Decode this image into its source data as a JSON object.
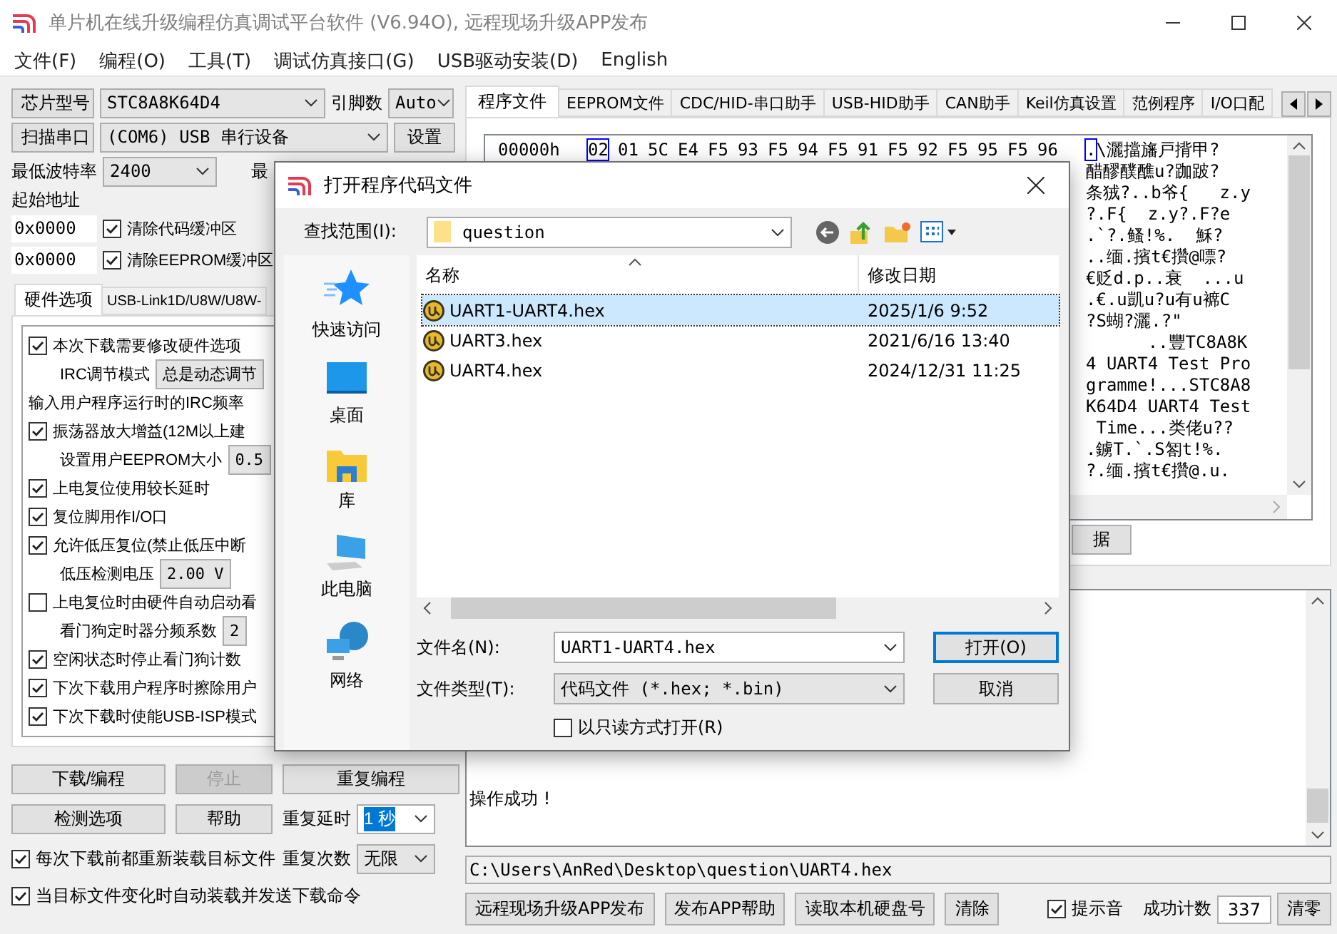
{
  "window": {
    "title": "单片机在线升级编程仿真调试平台软件 (V6.94O), 远程现场升级APP发布"
  },
  "menu": [
    "文件(F)",
    "编程(O)",
    "工具(T)",
    "调试仿真接口(G)",
    "USB驱动安装(D)",
    "English"
  ],
  "left_panel": {
    "chip_button": "芯片型号",
    "chip_model": "STC8A8K64D4",
    "pins_label": "引脚数",
    "pins": "Auto",
    "scan_button": "扫描串口",
    "port": "(COM6) USB 串行设备",
    "settings_button": "设置",
    "min_baud_label": "最低波特率",
    "min_baud": "2400",
    "max_baud_label": "最",
    "start_address_label": "起始地址",
    "address_rows": [
      {
        "address": "0x0000",
        "label": "清除代码缓冲区",
        "checked": true
      },
      {
        "address": "0x0000",
        "label": "清除EEPROM缓冲区",
        "checked": true
      }
    ],
    "tabs": [
      {
        "label": "硬件选项",
        "selected": true
      },
      {
        "label": "USB-Link1D/U8W/U8W-",
        "selected": false
      }
    ],
    "options": [
      {
        "kind": "checkbox",
        "label": "本次下载需要修改硬件选项",
        "checked": true
      },
      {
        "kind": "combo",
        "label": "IRC调节模式",
        "value": "总是动态调节"
      },
      {
        "kind": "text",
        "label": "输入用户程序运行时的IRC频率"
      },
      {
        "kind": "checkbox",
        "label": "振荡器放大增益(12M以上建",
        "checked": true
      },
      {
        "kind": "combo",
        "label": "设置用户EEPROM大小",
        "value": "0.5"
      },
      {
        "kind": "checkbox",
        "label": "上电复位使用较长延时",
        "checked": true
      },
      {
        "kind": "checkbox",
        "label": "复位脚用作I/O口",
        "checked": true
      },
      {
        "kind": "checkbox",
        "label": "允许低压复位(禁止低压中断",
        "checked": true
      },
      {
        "kind": "combo",
        "label": "低压检测电压",
        "value": "2.00 V"
      },
      {
        "kind": "checkbox",
        "label": "上电复位时由硬件自动启动看",
        "checked": false
      },
      {
        "kind": "combo",
        "label": "看门狗定时器分频系数",
        "value": "2"
      },
      {
        "kind": "checkbox",
        "label": "空闲状态时停止看门狗计数",
        "checked": true
      },
      {
        "kind": "checkbox",
        "label": "下次下载用户程序时擦除用户",
        "checked": true
      },
      {
        "kind": "checkbox",
        "label": "下次下载时使能USB-ISP模式",
        "checked": true
      }
    ],
    "buttons": [
      {
        "label": "下载/编程",
        "disabled": false
      },
      {
        "label": "停止",
        "disabled": true
      },
      {
        "label": "重复编程",
        "disabled": false
      },
      {
        "label": "检测选项",
        "disabled": false
      },
      {
        "label": "帮助",
        "disabled": false
      }
    ],
    "repeat_delay_label": "重复延时",
    "repeat_delay": "1 秒",
    "repeat_delay_focused": true,
    "repeat_count_label": "重复次数",
    "repeat_count": "无限",
    "bottom_checks": [
      {
        "label": "每次下载前都重新装载目标文件",
        "checked": true
      },
      {
        "label": "当目标文件变化时自动装载并发送下载命令",
        "checked": true
      }
    ]
  },
  "right_panel": {
    "tabs": [
      {
        "label": "程序文件",
        "selected": true
      },
      {
        "label": "EEPROM文件",
        "selected": false
      },
      {
        "label": "CDC/HID-串口助手",
        "selected": false
      },
      {
        "label": "USB-HID助手",
        "selected": false
      },
      {
        "label": "CAN助手",
        "selected": false
      },
      {
        "label": "Keil仿真设置",
        "selected": false
      },
      {
        "label": "范例程序",
        "selected": false
      },
      {
        "label": "I/O口配",
        "selected": false
      }
    ],
    "hex_view": {
      "offset": "00000h",
      "bytes": [
        {
          "text": "02",
          "selected": true
        },
        {
          "text": "01",
          "selected": false
        },
        {
          "text": "5C",
          "selected": false
        },
        {
          "text": "E4",
          "selected": false
        },
        {
          "text": "F5",
          "selected": false
        },
        {
          "text": "93",
          "selected": false
        },
        {
          "text": "F5",
          "selected": false
        },
        {
          "text": "94",
          "selected": false
        },
        {
          "text": "F5",
          "selected": false
        },
        {
          "text": "91",
          "selected": false
        },
        {
          "text": "F5",
          "selected": false
        },
        {
          "text": "92",
          "selected": false
        },
        {
          "text": "F5",
          "selected": false
        },
        {
          "text": "95",
          "selected": false
        },
        {
          "text": "F5",
          "selected": false
        },
        {
          "text": "96",
          "selected": false
        }
      ],
      "ascii_cursor": ".",
      "ascii_lines": [
        "\\灑擋旛戸揹甲?",
        "醋醪醭醮u?跏跛?",
        "条狨?..b爷{   z.y",
        "?.F{  z.y?.F?e",
        ".`?.鳋!%.  穌?",
        "..缅.擯t€攢@嘌?",
        "€贬d.p..衰  ...u",
        ".€.u凱u?u有u褯C",
        "?S蝴?灑.?\"",
        "      ..豐TC8A8K",
        "4 UART4 Test Pro",
        "gramme!...STC8A8",
        "K64D4 UART4 Test",
        " Time...类佬u??",
        ".鐪T.`.S匒t!%.",
        "?.缅.擯t€攢@.u."
      ]
    },
    "data_button": "据",
    "log": [
      "操作成功 !"
    ],
    "path": "C:\\Users\\AnRed\\Desktop\\question\\UART4.hex",
    "buttons": [
      "远程现场升级APP发布",
      "发布APP帮助",
      "读取本机硬盘号",
      "清除"
    ],
    "beep": {
      "label": "提示音",
      "checked": true
    },
    "success_label": "成功计数",
    "success_count": "337",
    "reset_button": "清零"
  },
  "dialog": {
    "title": "打开程序代码文件",
    "look_in_label": "查找范围(I):",
    "look_in": "question",
    "places": [
      {
        "label": "快速访问",
        "kind": "quick"
      },
      {
        "label": "桌面",
        "kind": "desktop"
      },
      {
        "label": "库",
        "kind": "library"
      },
      {
        "label": "此电脑",
        "kind": "computer"
      },
      {
        "label": "网络",
        "kind": "network"
      }
    ],
    "columns": [
      "名称",
      "修改日期"
    ],
    "files": [
      {
        "name": "UART1-UART4.hex",
        "modified": "2025/1/6 9:52",
        "selected": true
      },
      {
        "name": "UART3.hex",
        "modified": "2021/6/16 13:40",
        "selected": false
      },
      {
        "name": "UART4.hex",
        "modified": "2024/12/31 11:25",
        "selected": false
      }
    ],
    "file_name_label": "文件名(N):",
    "file_name": "UART1-UART4.hex",
    "file_type_label": "文件类型(T):",
    "file_type": "代码文件 (*.hex; *.bin)",
    "read_only": {
      "label": "以只读方式打开(R)",
      "checked": false
    },
    "open_button": {
      "label": "打开(O)",
      "default": true
    },
    "cancel_button": "取消"
  }
}
